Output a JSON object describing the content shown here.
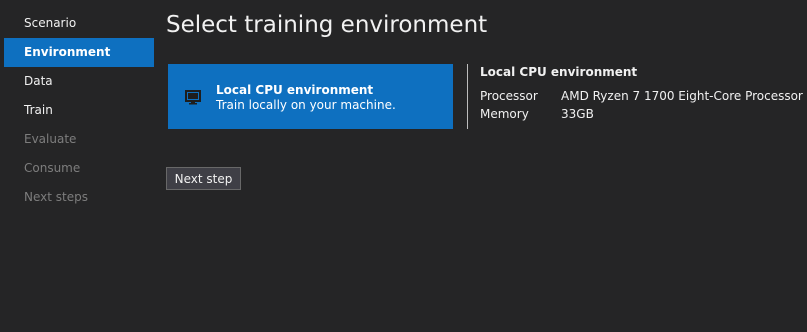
{
  "nav": {
    "items": [
      {
        "label": "Scenario",
        "state": "normal"
      },
      {
        "label": "Environment",
        "state": "active"
      },
      {
        "label": "Data",
        "state": "normal"
      },
      {
        "label": "Train",
        "state": "normal"
      },
      {
        "label": "Evaluate",
        "state": "disabled"
      },
      {
        "label": "Consume",
        "state": "disabled"
      },
      {
        "label": "Next steps",
        "state": "disabled"
      }
    ]
  },
  "page": {
    "title": "Select training environment"
  },
  "environment_card": {
    "icon": "monitor-icon",
    "name": "Local CPU environment",
    "description": "Train locally on your machine."
  },
  "details": {
    "title": "Local CPU environment",
    "processor_label": "Processor",
    "processor_value": "AMD Ryzen 7 1700 Eight-Core Processor",
    "memory_label": "Memory",
    "memory_value": "33GB"
  },
  "actions": {
    "next_step_label": "Next step"
  },
  "colors": {
    "background": "#252526",
    "accent": "#0e70c0",
    "text": "#f1f1f1",
    "disabled_text": "#7d7d7d"
  }
}
